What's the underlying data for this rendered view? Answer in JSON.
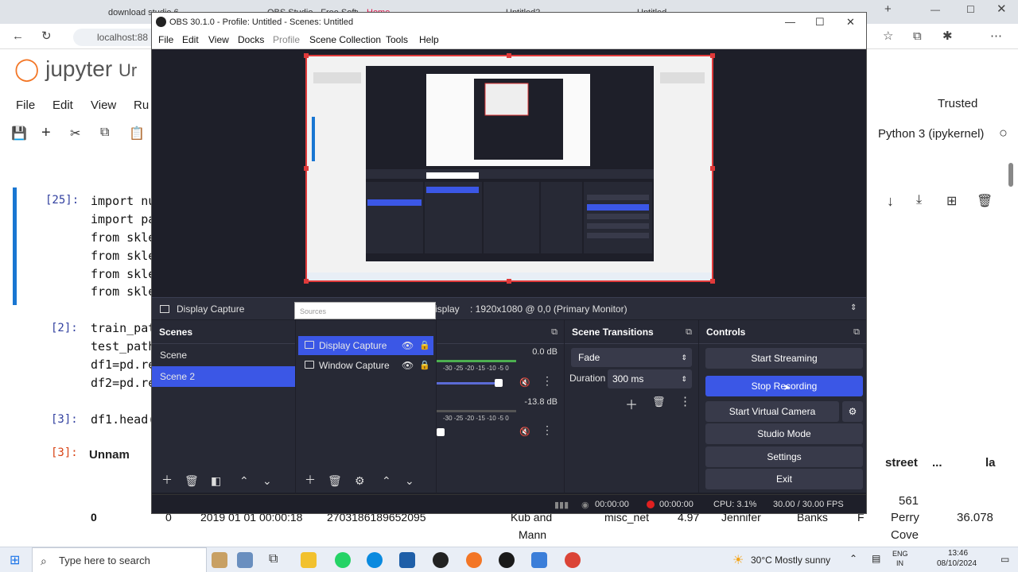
{
  "browser": {
    "tabs": [
      "download studio 6",
      "OBS Studio - Free Softw",
      "Home",
      "Untitled2",
      "Untitled"
    ],
    "address": "localhost:88"
  },
  "jupyter": {
    "logo_text": "jupyter",
    "title_fragment": "Ur",
    "menu": [
      "File",
      "Edit",
      "View",
      "Ru"
    ],
    "trusted": "Trusted",
    "kernel": "Python 3 (ipykernel)",
    "cells": [
      {
        "prompt": "[25]:",
        "lines": [
          "import nu",
          "import pa",
          "from skle",
          "from skle",
          "from skle",
          "from skle"
        ]
      },
      {
        "prompt": "[2]:",
        "lines": [
          "train_pat",
          "test_path",
          "df1=pd.re",
          "df2=pd.re"
        ]
      },
      {
        "prompt": "[3]:",
        "lines": [
          "df1.head("
        ]
      },
      {
        "prompt": "[3]:",
        "lines": [
          "Unnam"
        ]
      }
    ],
    "table_header": {
      "street": "street",
      "ellipsis": "...",
      "la": "la"
    },
    "table_side": [
      "561",
      "Perry",
      "Cove",
      "36.078"
    ],
    "table_row": {
      "index": "0",
      "zero": "0",
      "datetime": "2019 01 01 00:00:18",
      "num": "2703186189652095",
      "merchant1": "Kub and",
      "merchant2": "Mann",
      "category": "misc_net",
      "amt": "4.97",
      "first": "Jennifer",
      "last": "Banks",
      "gender": "F"
    }
  },
  "obs": {
    "title": "OBS 30.1.0 - Profile: Untitled - Scenes: Untitled",
    "menu": [
      "File",
      "Edit",
      "View",
      "Docks",
      "Profile",
      "Scene Collection",
      "Tools",
      "Help"
    ],
    "source_bar": {
      "source": "Display Capture",
      "display_label": "isplay",
      "display_value": ": 1920x1080 @ 0,0 (Primary Monitor)"
    },
    "sources_popup": "Sources",
    "scenes": {
      "header": "Scenes",
      "items": [
        "Scene",
        "Scene 2"
      ],
      "selected": 1
    },
    "sources": {
      "items": [
        {
          "label": "Display Capture",
          "selected": true
        },
        {
          "label": "Window Capture",
          "selected": false
        }
      ]
    },
    "mixer": {
      "channels": [
        {
          "db": "0.0 dB",
          "scale": "-30  -25  -20  -15  -10   -5   0",
          "level": 0.78
        },
        {
          "db": "-13.8 dB",
          "scale": "-30  -25  -20  -15  -10   -5   0",
          "level": 0.03
        }
      ]
    },
    "transitions": {
      "header": "Scene Transitions",
      "type": "Fade",
      "duration_label": "Duration",
      "duration_value": "300 ms"
    },
    "controls": {
      "header": "Controls",
      "buttons": [
        "Start Streaming",
        "Stop Recording",
        "Start Virtual Camera",
        "Studio Mode",
        "Settings",
        "Exit"
      ],
      "active": "Stop Recording"
    },
    "status": {
      "stream_time": "00:00:00",
      "rec_time": "00:00:00",
      "cpu": "CPU: 3.1%",
      "fps": "30.00 / 30.00 FPS"
    }
  },
  "taskbar": {
    "search_placeholder": "Type here to search",
    "weather": "30°C  Mostly sunny",
    "lang1": "ENG",
    "lang2": "IN",
    "time": "13:46",
    "date": "08/10/2024"
  }
}
